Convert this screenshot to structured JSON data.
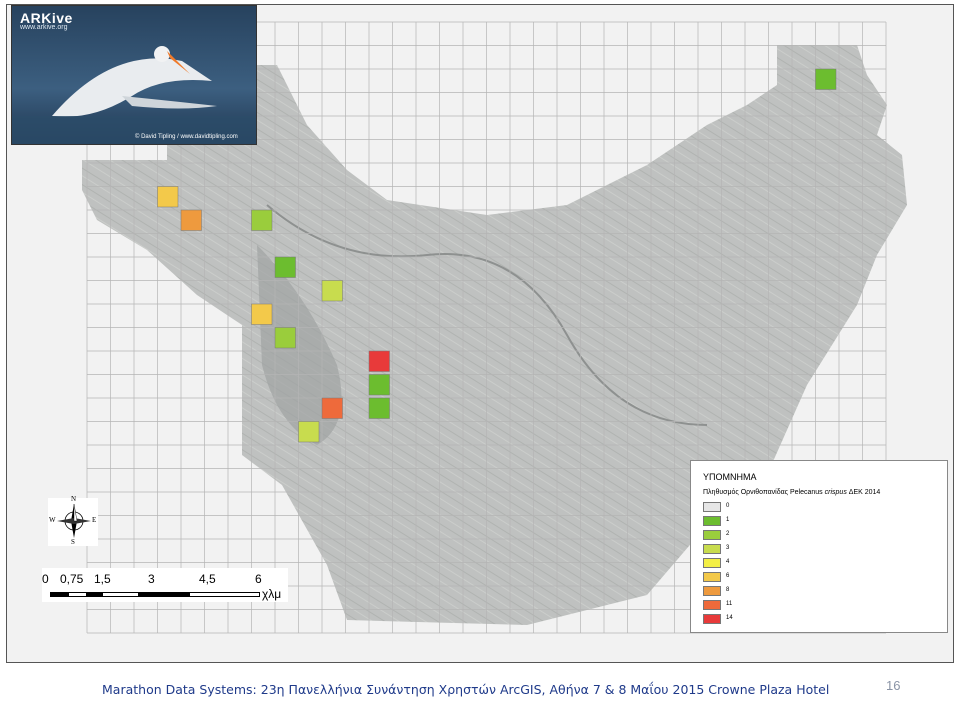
{
  "photo": {
    "brand": "ARKive",
    "brand_url": "www.arkive.org",
    "credit": "© David Tipling / www.davidtipling.com"
  },
  "compass": {
    "n": "N",
    "e": "E",
    "s": "S",
    "w": "W"
  },
  "scale_bar": {
    "ticks": [
      "0",
      "0,75",
      "1,5",
      "3",
      "4,5",
      "6"
    ],
    "unit": "χλμ"
  },
  "legend": {
    "title": "ΥΠΟΜΝΗΜΑ",
    "subtitle_before": "Πληθυσμός Ορνιθοπανίδας Pelecanus ",
    "subtitle_italic": "crispus",
    "subtitle_after": " ΔΕΚ 2014",
    "classes": [
      {
        "label": "0",
        "color": "#e6e6e6"
      },
      {
        "label": "1",
        "color": "#6cbd2f"
      },
      {
        "label": "2",
        "color": "#9acd3c"
      },
      {
        "label": "3",
        "color": "#c8dc4e"
      },
      {
        "label": "4",
        "color": "#f3ef45"
      },
      {
        "label": "6",
        "color": "#f3c94a"
      },
      {
        "label": "8",
        "color": "#ee9a3e"
      },
      {
        "label": "11",
        "color": "#ee6a3b"
      },
      {
        "label": "14",
        "color": "#e83a3a"
      }
    ]
  },
  "survey_cells": [
    {
      "col": 31,
      "row": 2,
      "value": 1
    },
    {
      "col": 3,
      "row": 7,
      "value": 6
    },
    {
      "col": 4,
      "row": 8,
      "value": 8
    },
    {
      "col": 7,
      "row": 8,
      "value": 2
    },
    {
      "col": 8,
      "row": 10,
      "value": 1
    },
    {
      "col": 10,
      "row": 11,
      "value": 3
    },
    {
      "col": 7,
      "row": 12,
      "value": 6
    },
    {
      "col": 8,
      "row": 13,
      "value": 2
    },
    {
      "col": 12,
      "row": 14,
      "value": 14
    },
    {
      "col": 12,
      "row": 15,
      "value": 1
    },
    {
      "col": 10,
      "row": 16,
      "value": 11
    },
    {
      "col": 12,
      "row": 16,
      "value": 1
    },
    {
      "col": 9,
      "row": 17,
      "value": 3
    }
  ],
  "footer": {
    "text": "Marathon Data Systems: 23η Πανελλήνια Συνάντηση Χρηστών ArcGIS, Αθήνα 7 & 8 Μαΐου 2015 Crowne Plaza Hotel",
    "page_number": "16"
  }
}
